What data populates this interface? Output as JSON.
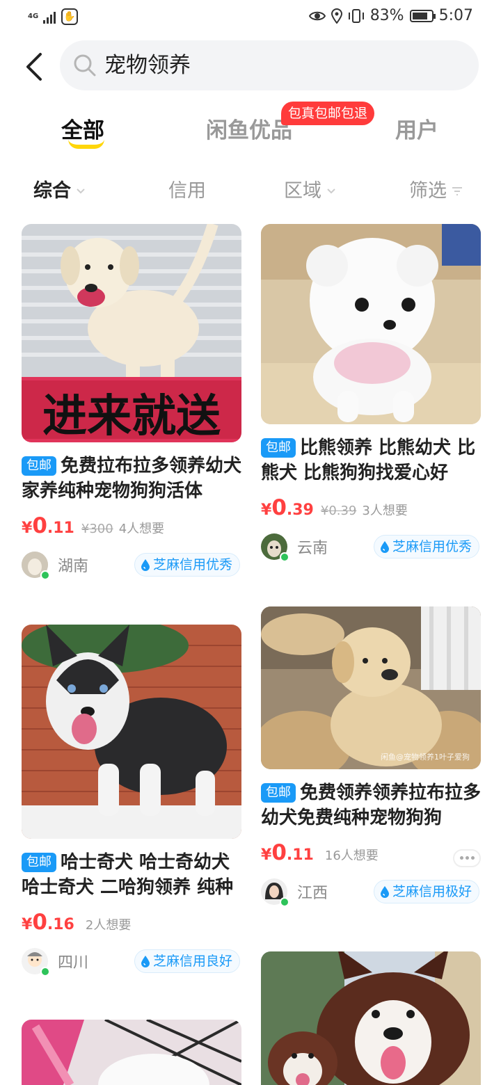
{
  "status_bar": {
    "network": "4G",
    "battery_percent_text": "83%",
    "battery_level": 0.83,
    "time": "5:07"
  },
  "search": {
    "query": "宠物领养"
  },
  "tabs": [
    {
      "label": "全部",
      "active": true
    },
    {
      "label": "闲鱼优品",
      "active": false,
      "badge": "包真包邮包退"
    },
    {
      "label": "用户",
      "active": false
    }
  ],
  "filters": [
    {
      "label": "综合",
      "active": true,
      "icon": "chevron-down-icon"
    },
    {
      "label": "信用",
      "active": false
    },
    {
      "label": "区域",
      "active": false,
      "icon": "chevron-down-icon"
    },
    {
      "label": "筛选",
      "active": false,
      "icon": "funnel-icon"
    }
  ],
  "products": [
    {
      "tag": "包邮",
      "title": "免费拉布拉多领养幼犬家养纯种宠物狗狗活体",
      "image_caption": "进来就送",
      "currency": "¥",
      "price_int": "0",
      "price_dec": ".11",
      "original_price": "¥300",
      "want": "4人想要",
      "region": "湖南",
      "credit": "芝麻信用优秀"
    },
    {
      "tag": "包邮",
      "title": "比熊领养 比熊幼犬 比熊犬 比熊狗狗找爱心好",
      "currency": "¥",
      "price_int": "0",
      "price_dec": ".39",
      "original_price": "¥0.39",
      "want": "3人想要",
      "region": "云南",
      "credit": "芝麻信用优秀"
    },
    {
      "tag": "包邮",
      "title": "哈士奇犬 哈士奇幼犬 哈士奇犬 二哈狗领养 纯种",
      "currency": "¥",
      "price_int": "0",
      "price_dec": ".16",
      "want": "2人想要",
      "region": "四川",
      "credit": "芝麻信用良好"
    },
    {
      "tag": "包邮",
      "title": "免费领养领养拉布拉多幼犬免费纯种宠物狗狗",
      "image_watermark": "闲鱼@宠物领养1叶子爱狗",
      "currency": "¥",
      "price_int": "0",
      "price_dec": ".11",
      "want": "16人想要",
      "region": "江西",
      "credit": "芝麻信用极好"
    }
  ],
  "colors": {
    "accent_yellow": "#ffd60a",
    "price_red": "#ff4040",
    "tag_blue": "#1a9af7",
    "badge_red": "#ff3b3b",
    "online_green": "#2ec35a"
  }
}
